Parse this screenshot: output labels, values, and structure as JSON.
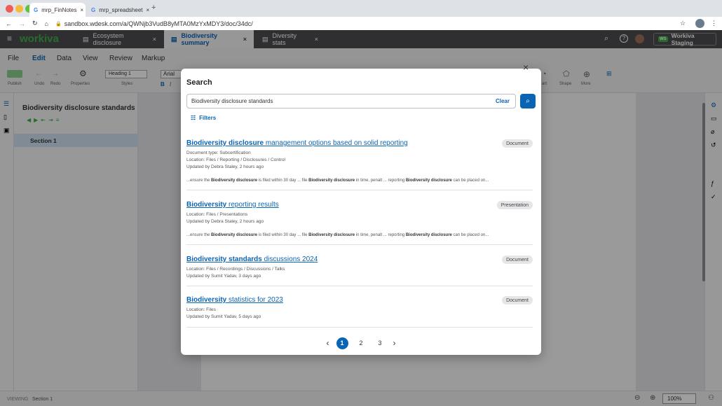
{
  "browser": {
    "tabs": [
      {
        "label": "mrp_FinNotes",
        "close": "×"
      },
      {
        "label": "mrp_spreadsheet",
        "close": "×"
      }
    ],
    "url": "sandbox.wdesk.com/a/QWNjb3VudB8yMTA0MzYxMDY3/doc/34dc/"
  },
  "app": {
    "brand": "workiva",
    "doc_tabs": [
      {
        "label": "Ecosystem disclosure",
        "close": "×"
      },
      {
        "label": "Biodiversity summary",
        "close": "×"
      },
      {
        "label": "Diversity stats",
        "close": "×"
      }
    ],
    "workspace_badge": "WS",
    "workspace": "Workiva Staging"
  },
  "menu": {
    "items": [
      "File",
      "Edit",
      "Data",
      "View",
      "Review",
      "Markup"
    ]
  },
  "ribbon": {
    "publish": "Publish",
    "undo": "Undo",
    "redo": "Redo",
    "properties": "Properties",
    "heading": "Heading 1",
    "styles": "Styles",
    "font": "Arial",
    "chart": "art",
    "shape": "Shape",
    "more": "More"
  },
  "outline": {
    "title": "Biodiversity disclosure standards",
    "section": "Section 1"
  },
  "status": {
    "mode": "VIEWING",
    "section": "Section 1",
    "zoom": "100%"
  },
  "search": {
    "title": "Search",
    "query": "Biodiversity disclosure standards",
    "clear": "Clear",
    "filters": "Filters",
    "results": [
      {
        "title_bold": "Biodiversity disclosure",
        "title_rest": " management options based on solid reporting",
        "badge": "Document",
        "meta": [
          "Document type: Subcertification",
          "Location: Files / Reporting / Disclosures / Control",
          "Updated by Debra Staley, 2 hours ago"
        ],
        "snippet": {
          "p1": "...ensure the ",
          "b1": "Biodiversity disclosure",
          "p2": " is filed within 30 day ... file ",
          "b2": "Biodiversity disclosure",
          "p3": " in time, penalt ... reporting ",
          "b3": "Biodiversity disclosure",
          "p4": " can be placed on..."
        }
      },
      {
        "title_bold": "Biodiversity",
        "title_rest": " reporting results",
        "badge": "Presentation",
        "meta": [
          "Location: Files / Presentations",
          "Updated by Debra Staley, 2 hours ago"
        ],
        "snippet": {
          "p1": "...ensure the ",
          "b1": "Biodiversity disclosure",
          "p2": " is filed within 30 day ... file ",
          "b2": "Biodiversity disclosure",
          "p3": " in time, penalt ... reporting ",
          "b3": "Biodiversity disclosure",
          "p4": " can be placed on..."
        }
      },
      {
        "title_bold": "Biodiversity standards",
        "title_rest": " discussions 2024",
        "badge": "Document",
        "meta": [
          "Location: Files / Recordings / Discussions / Talks",
          "Updated by Sumit Yadav, 3 days ago"
        ]
      },
      {
        "title_bold": "Biodiversity",
        "title_rest": " statistics for 2023",
        "badge": "Document",
        "meta": [
          "Location: Files",
          "Updated by Sumit Yadav, 5 days ago"
        ]
      }
    ],
    "pages": [
      "1",
      "2",
      "3"
    ],
    "prev": "‹",
    "next": "›",
    "close": "×"
  },
  "colors": {
    "accent": "#0a64b4",
    "brand_green": "#3fae49",
    "appbar": "#4d4d50"
  }
}
